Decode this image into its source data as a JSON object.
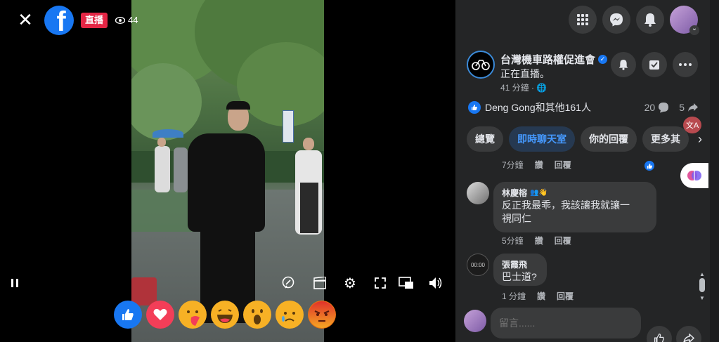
{
  "video": {
    "live_label": "直播",
    "viewer_count": "44"
  },
  "reactions": [
    "like-icon",
    "love-icon",
    "care-icon",
    "haha-icon",
    "wow-icon",
    "sad-icon",
    "angry-icon"
  ],
  "page": {
    "name": "台灣機車路權促進會",
    "status": "正在直播。",
    "time_ago": "41 分鐘 · "
  },
  "engagement": {
    "reactors": "Deng Gong和其他161人",
    "comment_count": "20",
    "share_count": "5"
  },
  "tabs": [
    "總覽",
    "即時聊天室",
    "你的回覆",
    "更多其"
  ],
  "comments": [
    {
      "meta_time": "7分鐘",
      "like": "讚",
      "reply": "回覆"
    },
    {
      "name": "林慶榕",
      "text_line1": "反正我最乖，我該讓我就讓一",
      "text_line2": "視同仁",
      "meta_time": "5分鐘",
      "like": "讚",
      "reply": "回覆"
    },
    {
      "name": "張霞飛",
      "text_line1": "巴士道?",
      "meta_time": "1 分鐘",
      "like": "讚",
      "reply": "回覆"
    }
  ],
  "composer": {
    "placeholder": "留言......"
  },
  "translate_label": "文A",
  "colors": {
    "accent": "#1877f2",
    "live": "#e42645",
    "panel": "#242526",
    "bubble": "#3a3b3c"
  }
}
